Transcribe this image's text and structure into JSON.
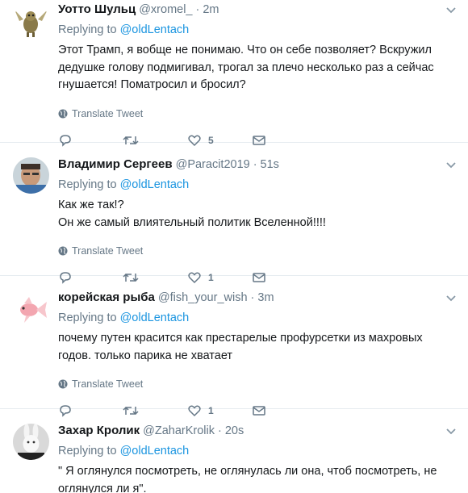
{
  "tweets": [
    {
      "name": "Уотто Шульц",
      "handle": "@xromel_",
      "time": "2m",
      "replying_label": "Replying to",
      "replying_handle": "@oldLentach",
      "text": "Этот Трамп, я вобще не понимаю. Что он себе позволяет? Вскружил дедушке голову подмигивал, трогал за плечо несколько раз а сейчас гнушается! Поматросил и бросил?",
      "translate": "Translate Tweet",
      "likes": "5",
      "avatar": "winged-creature-avatar"
    },
    {
      "name": "Владимир Сергеев",
      "handle": "@Paracit2019",
      "time": "51s",
      "replying_label": "Replying to",
      "replying_handle": "@oldLentach",
      "text": "Как же так!?\nОн же самый влиятельный политик Вселенной!!!!",
      "translate": "Translate Tweet",
      "likes": "1",
      "avatar": "man-photo-avatar"
    },
    {
      "name": "корейская рыба",
      "handle": "@fish_your_wish",
      "time": "3m",
      "replying_label": "Replying to",
      "replying_handle": "@oldLentach",
      "text": "почему путен красится как престарелые профурсетки из махровых годов. только парика не хватает",
      "translate": "Translate Tweet",
      "likes": "1",
      "avatar": "goldfish-avatar"
    },
    {
      "name": "Захар Кролик",
      "handle": "@ZaharKrolik",
      "time": "20s",
      "replying_label": "Replying to",
      "replying_handle": "@oldLentach",
      "text": "\" Я оглянулся посмотреть, не оглянулась ли она, чтоб посмотреть, не оглянулся ли я\".",
      "avatar": "rabbit-mask-avatar"
    }
  ],
  "dot": "·",
  "colors": {
    "link": "#1b95e0",
    "muted": "#657786",
    "text": "#14171a",
    "divider": "#e6ecf0"
  }
}
